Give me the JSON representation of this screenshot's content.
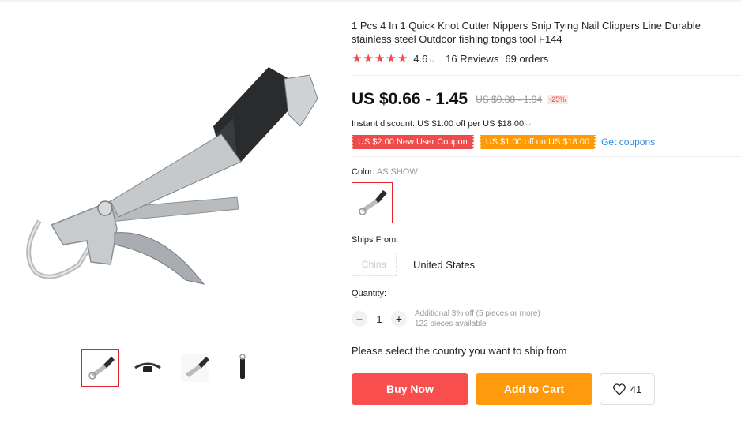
{
  "product": {
    "title": "1 Pcs 4 In 1 Quick Knot Cutter Nippers Snip Tying Nail Clippers Line Durable stainless steel Outdoor fishing tongs tool F144",
    "rating": "4.6",
    "reviews": "16 Reviews",
    "orders": "69 orders",
    "star_count": 5,
    "price": "US $0.66 - 1.45",
    "old_price": "US $0.88 - 1.94",
    "discount": "-25%",
    "instant_discount": "Instant discount: US $1.00 off per US $18.00",
    "coupons": [
      "US $2.00 New User Coupon",
      "US $1.00 off on US $18.00"
    ],
    "get_coupons": "Get coupons"
  },
  "options": {
    "color_label": "Color:",
    "color_value": "AS SHOW",
    "ships_from_label": "Ships From:",
    "ships_from_options": [
      "China",
      "United States"
    ],
    "quantity_label": "Quantity:",
    "quantity": "1",
    "quantity_info_1": "Additional 3% off (5 pieces or more)",
    "quantity_info_2": "122 pieces available",
    "ship_note": "Please select the country you want to ship from"
  },
  "actions": {
    "buy_now": "Buy Now",
    "add_to_cart": "Add to Cart",
    "wishlist_count": "41"
  },
  "colors": {
    "accent_red": "#f94e4e",
    "accent_orange": "#ff9a0c",
    "link_blue": "#2e8ee0",
    "star": "#f44c4c"
  },
  "icons": [
    "star-icon",
    "chevron-down-icon",
    "minus-icon",
    "plus-icon",
    "heart-icon"
  ]
}
